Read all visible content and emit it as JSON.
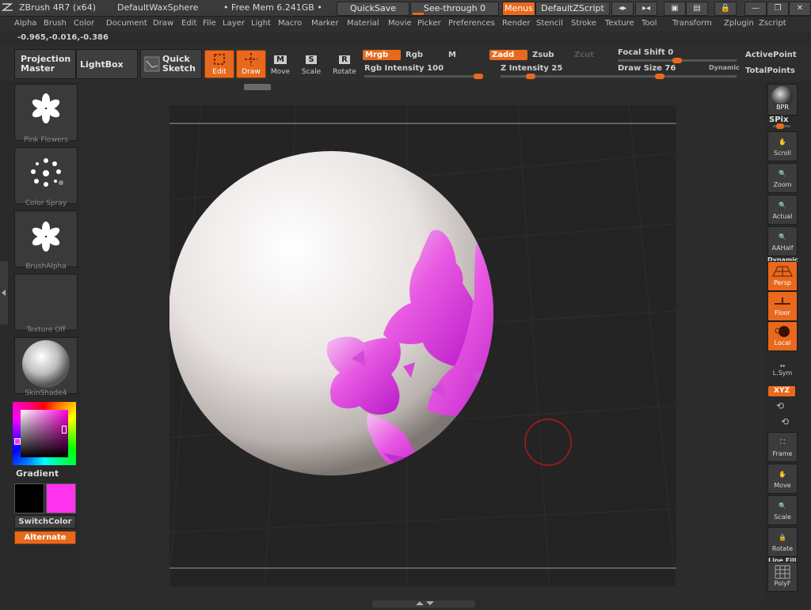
{
  "titlebar": {
    "app": "ZBrush 4R7 (x64)",
    "document": "DefaultWaxSphere",
    "mem": "• Free Mem 6.241GB •",
    "quicksave": "QuickSave",
    "seethrough": "See-through   0",
    "menus": "Menus",
    "script": "DefaultZScript"
  },
  "menubar": [
    "Alpha",
    "Brush",
    "Color",
    "Document",
    "Draw",
    "Edit",
    "File",
    "Layer",
    "Light",
    "Macro",
    "Marker",
    "Material",
    "Movie",
    "Picker",
    "Preferences",
    "Render",
    "Stencil",
    "Stroke",
    "Texture",
    "Tool",
    "Transform",
    "Zplugin",
    "Zscript"
  ],
  "coords": "-0.965,-0.016,-0.386",
  "toolbar": {
    "projection_master": "Projection\nMaster",
    "lightbox": "LightBox",
    "quick_sketch": "Quick\nSketch",
    "edit": "Edit",
    "draw": "Draw",
    "move": "Move",
    "scale": "Scale",
    "rotate": "Rotate",
    "mrgb": "Mrgb",
    "rgb": "Rgb",
    "m": "M",
    "zadd": "Zadd",
    "zsub": "Zsub",
    "zcut": "Zcut",
    "rgb_intensity": "Rgb  Intensity 100",
    "z_intensity": "Z  Intensity 25",
    "focal_shift": "Focal  Shift 0",
    "draw_size": "Draw  Size 76",
    "dynamic": "Dynamic",
    "active_points": "ActivePoint",
    "total_points": "TotalPoints"
  },
  "levels": {
    "rgb_intensity": 1.0,
    "z_intensity": 0.25,
    "focal_shift": 0.5,
    "draw_size": 0.35
  },
  "leftpanel": {
    "brush": "Pink Flowers",
    "stroke": "Color Spray",
    "alpha": "BrushAlpha",
    "texture": "Texture Off",
    "material": "SkinShade4",
    "gradient": "Gradient",
    "switchcolor": "SwitchColor",
    "alternate": "Alternate",
    "main_color": "#ff33ee",
    "secondary_color": "#000000"
  },
  "rightpanel": {
    "bpr": "BPR",
    "spix": "SPix",
    "scroll": "Scroll",
    "zoom": "Zoom",
    "actual": "Actual",
    "aahalf": "AAHalf",
    "dynamic": "Dynamic",
    "persp": "Persp",
    "floor": "Floor",
    "local": "Local",
    "lsym": "L.Sym",
    "xyz": "XYZ",
    "frame": "Frame",
    "move": "Move",
    "scale": "Scale",
    "rotate": "Rotate",
    "line_fill": "Line Fill",
    "polyf": "PolyF"
  },
  "accent_color": "#e8691d"
}
